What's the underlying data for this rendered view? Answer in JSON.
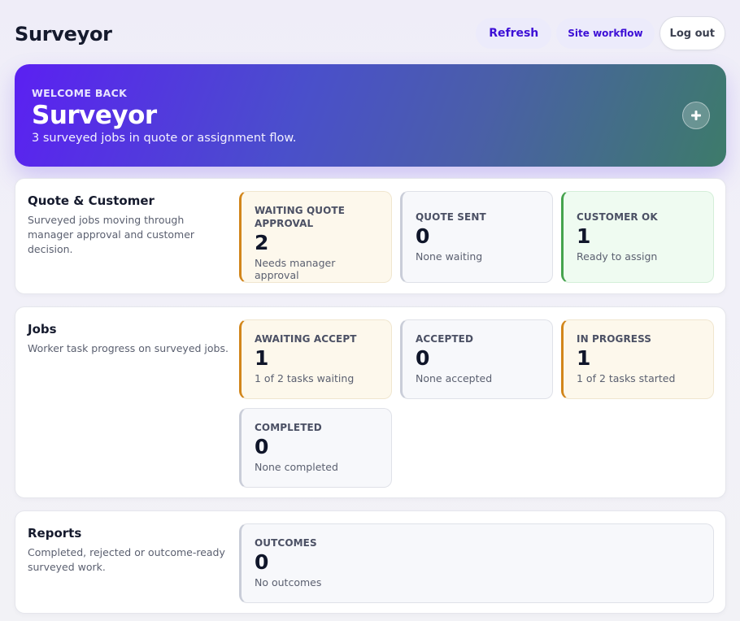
{
  "header": {
    "title": "Surveyor",
    "refresh_label": "Refresh",
    "workflow_label": "Site workflow",
    "logout_label": "Log out"
  },
  "hero": {
    "eyebrow": "WELCOME BACK",
    "title": "Surveyor",
    "subtitle": "3 surveyed jobs in quote or assignment flow.",
    "add_icon": "plus-icon"
  },
  "sections": {
    "quote": {
      "title": "Quote & Customer",
      "description": "Surveyed jobs moving through manager approval and customer decision.",
      "cards": [
        {
          "label": "WAITING QUOTE APPROVAL",
          "value": "2",
          "note": "Needs manager approval",
          "tone": "warn"
        },
        {
          "label": "QUOTE SENT",
          "value": "0",
          "note": "None waiting",
          "tone": "neutral"
        },
        {
          "label": "CUSTOMER OK",
          "value": "1",
          "note": "Ready to assign",
          "tone": "ok"
        }
      ]
    },
    "jobs": {
      "title": "Jobs",
      "description": "Worker task progress on surveyed jobs.",
      "cards": [
        {
          "label": "AWAITING ACCEPT",
          "value": "1",
          "note": "1 of 2 tasks waiting",
          "tone": "warn"
        },
        {
          "label": "ACCEPTED",
          "value": "0",
          "note": "None accepted",
          "tone": "neutral"
        },
        {
          "label": "IN PROGRESS",
          "value": "1",
          "note": "1 of 2 tasks started",
          "tone": "warn"
        },
        {
          "label": "COMPLETED",
          "value": "0",
          "note": "None completed",
          "tone": "neutral"
        }
      ]
    },
    "reports": {
      "title": "Reports",
      "description": "Completed, rejected or outcome-ready surveyed work.",
      "cards": [
        {
          "label": "OUTCOMES",
          "value": "0",
          "note": "No outcomes",
          "tone": "neutral"
        }
      ]
    }
  },
  "colors": {
    "accent": "#3d0fd6",
    "warn": "#d2861b",
    "ok": "#46a34e",
    "neutral": "#c9cdd8"
  }
}
